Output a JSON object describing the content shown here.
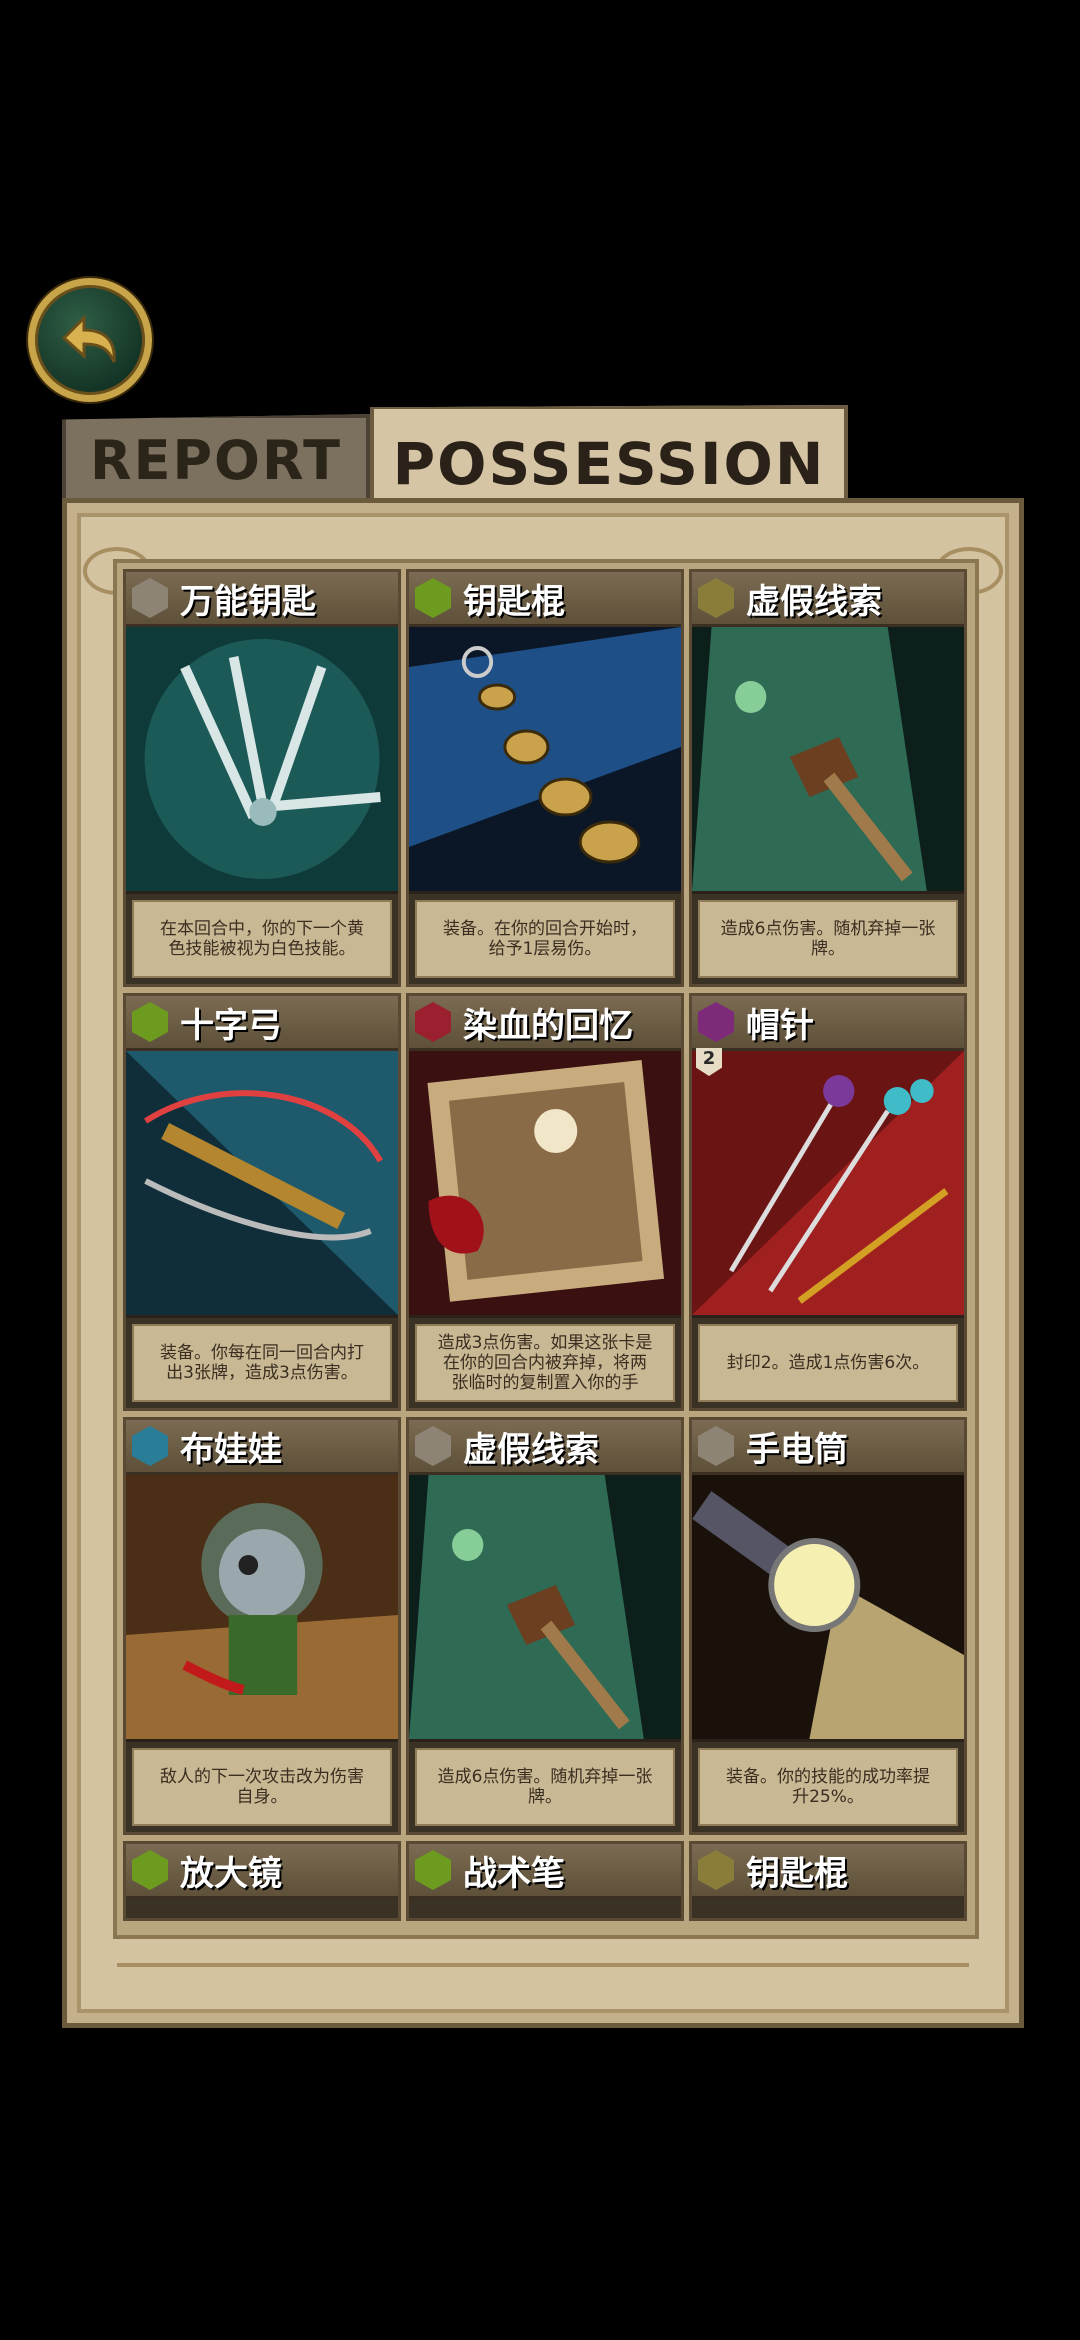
{
  "tabs": {
    "report": "REPORT",
    "possession": "POSSESSION"
  },
  "icons": {
    "back": "back-arrow-icon"
  },
  "cards": [
    {
      "name": "万能钥匙",
      "gem": "gray",
      "art": "multitool",
      "desc": "在本回合中，你的下一个黄\n色技能被视为白色技能。"
    },
    {
      "name": "钥匙棍",
      "gem": "green",
      "art": "keystick",
      "desc": "装备。在你的回合开始时，\n给予1层易伤。"
    },
    {
      "name": "虚假线索",
      "gem": "olive",
      "art": "hammer",
      "desc": "造成6点伤害。随机弃掉一张\n牌。"
    },
    {
      "name": "十字弓",
      "gem": "green",
      "art": "crossbow",
      "desc": "装备。你每在同一回合内打\n出3张牌，造成3点伤害。"
    },
    {
      "name": "染血的回忆",
      "gem": "red",
      "art": "photo",
      "desc": "造成3点伤害。如果这张卡是\n在你的回合内被弃掉，将两\n张临时的复制置入你的手"
    },
    {
      "name": "帽针",
      "gem": "purple",
      "art": "hatpin",
      "badge": "2",
      "desc": "封印2。造成1点伤害6次。"
    },
    {
      "name": "布娃娃",
      "gem": "teal",
      "art": "doll",
      "desc": "敌人的下一次攻击改为伤害\n自身。"
    },
    {
      "name": "虚假线索",
      "gem": "gray",
      "art": "hammer",
      "desc": "造成6点伤害。随机弃掉一张\n牌。"
    },
    {
      "name": "手电筒",
      "gem": "gray",
      "art": "flashlight",
      "desc": "装备。你的技能的成功率提\n升25%。"
    },
    {
      "name": "放大镜",
      "gem": "green",
      "art": "none",
      "desc": ""
    },
    {
      "name": "战术笔",
      "gem": "green",
      "art": "none",
      "desc": ""
    },
    {
      "name": "钥匙棍",
      "gem": "olive",
      "art": "none",
      "desc": ""
    }
  ]
}
